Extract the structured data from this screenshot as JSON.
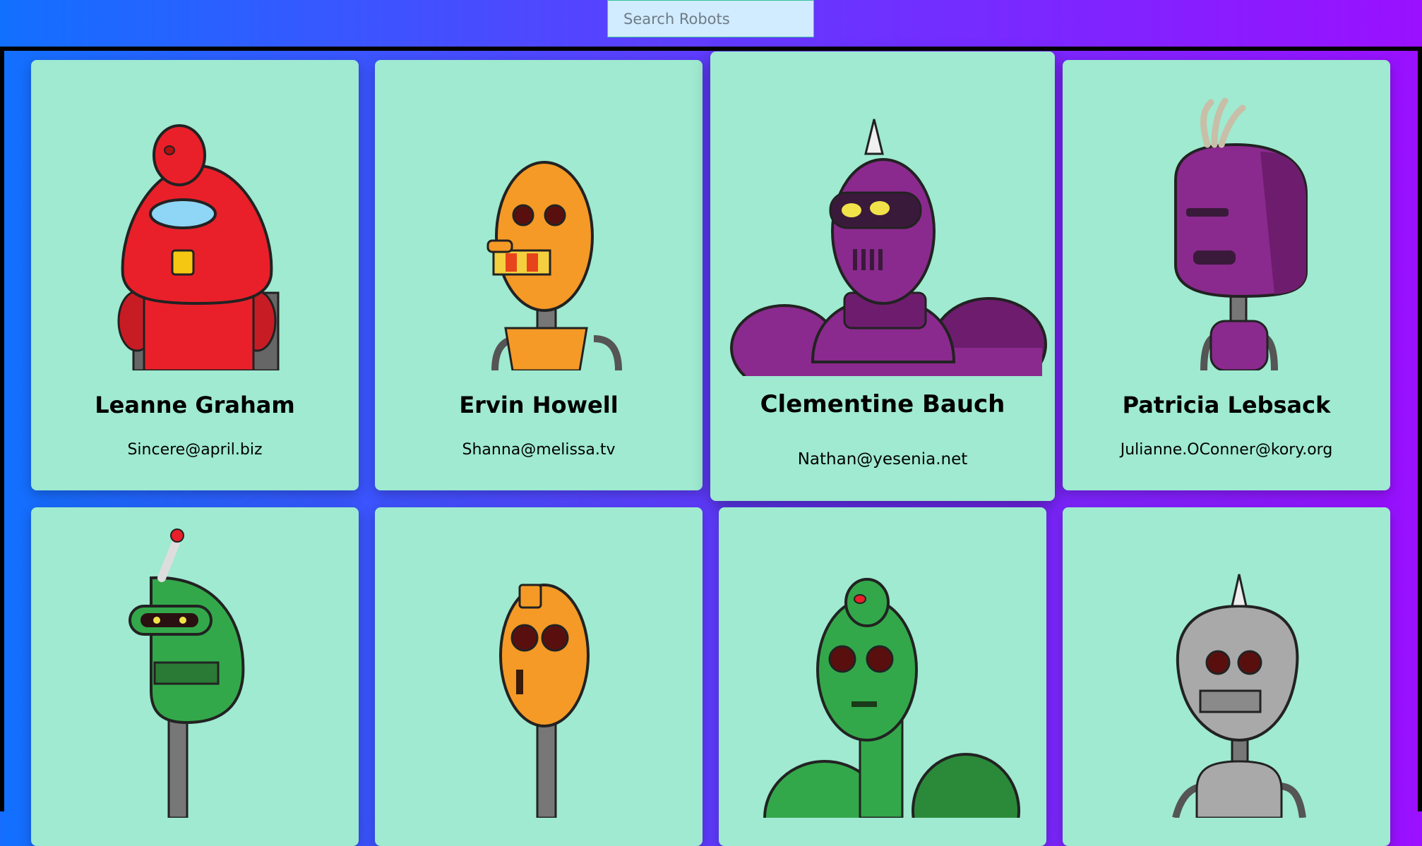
{
  "search": {
    "placeholder": "Search Robots"
  },
  "robots": [
    {
      "name": "Leanne Graham",
      "email": "Sincere@april.biz"
    },
    {
      "name": "Ervin Howell",
      "email": "Shanna@melissa.tv"
    },
    {
      "name": "Clementine Bauch",
      "email": "Nathan@yesenia.net"
    },
    {
      "name": "Patricia Lebsack",
      "email": "Julianne.OConner@kory.org"
    }
  ],
  "colors": {
    "card": "#9fead0",
    "robot_red": "#e9202a",
    "robot_orange": "#f59a26",
    "robot_purple": "#8a2a8e",
    "robot_green": "#33a84a",
    "robot_gray": "#9a9a9a"
  }
}
